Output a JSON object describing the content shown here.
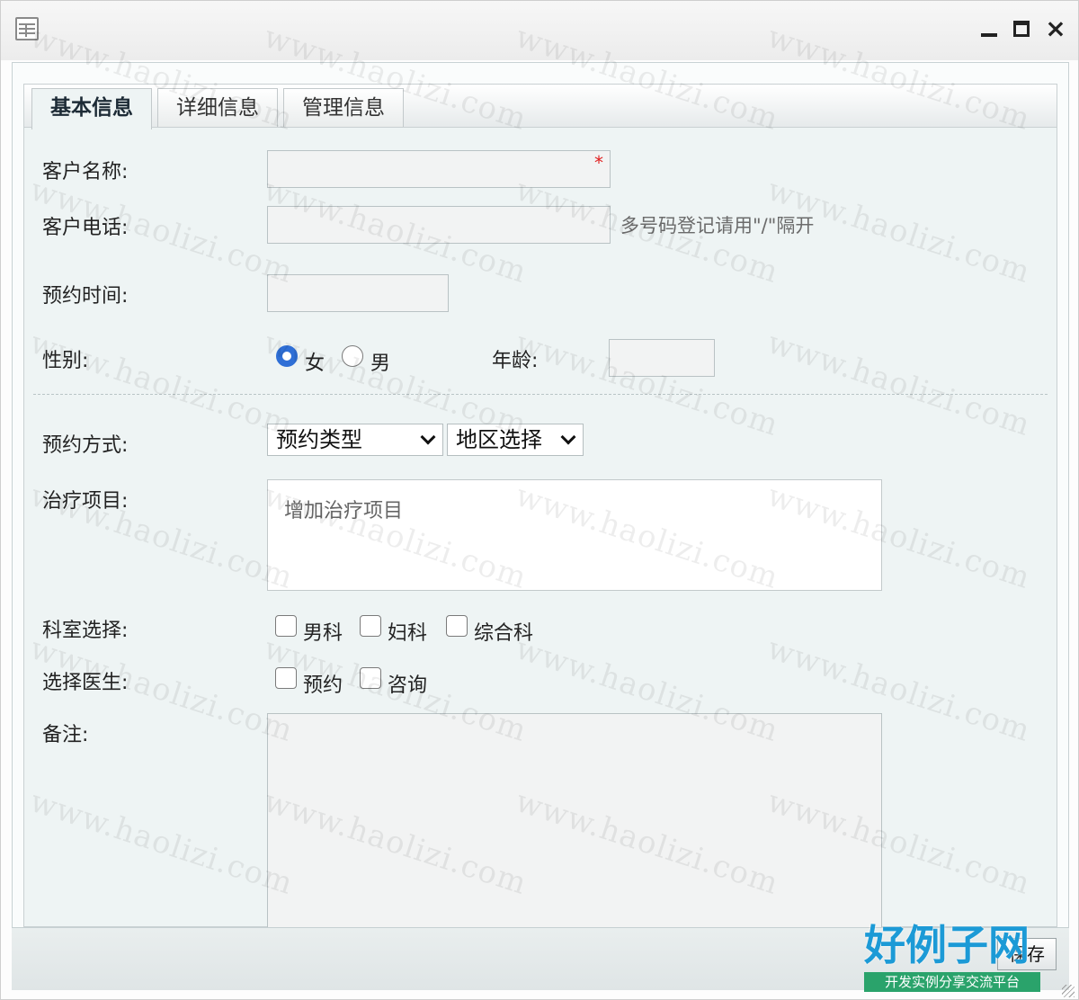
{
  "window": {
    "icon": "form-window-icon",
    "controls": {
      "minimize": "minimize-icon",
      "maximize": "maximize-icon",
      "close": "×"
    }
  },
  "tabs": [
    {
      "label": "基本信息",
      "active": true
    },
    {
      "label": "详细信息",
      "active": false
    },
    {
      "label": "管理信息",
      "active": false
    }
  ],
  "form": {
    "customer_name": {
      "label": "客户名称:",
      "value": "",
      "required_mark": "*"
    },
    "customer_phone": {
      "label": "客户电话:",
      "value": "",
      "hint": "多号码登记请用\"/\"隔开"
    },
    "appointment_time": {
      "label": "预约时间:",
      "value": ""
    },
    "gender": {
      "label": "性别:",
      "options": [
        {
          "label": "女",
          "checked": true
        },
        {
          "label": "男",
          "checked": false
        }
      ]
    },
    "age": {
      "label": "年龄:",
      "value": ""
    },
    "appointment_method": {
      "label": "预约方式:",
      "type_select": "预约类型",
      "region_select": "地区选择"
    },
    "treatment": {
      "label": "治疗项目:",
      "placeholder": "增加治疗项目"
    },
    "department": {
      "label": "科室选择:",
      "options": [
        {
          "label": "男科",
          "checked": false
        },
        {
          "label": "妇科",
          "checked": false
        },
        {
          "label": "综合科",
          "checked": false
        }
      ]
    },
    "doctor": {
      "label": "选择医生:",
      "options": [
        {
          "label": "预约",
          "checked": false
        },
        {
          "label": "咨询",
          "checked": false
        }
      ]
    },
    "remark": {
      "label": "备注:",
      "value": ""
    }
  },
  "footer": {
    "save_label": "保存"
  },
  "watermark": "www.haolizi.com",
  "logo": {
    "main": "好例子网",
    "sub": "开发实例分享交流平台"
  },
  "colors": {
    "accent": "#2f6fd6",
    "panel_bg": "#eef4f4",
    "required": "#e02020",
    "logo_blue": "#1c9ad6",
    "logo_green": "#2aa36b"
  }
}
